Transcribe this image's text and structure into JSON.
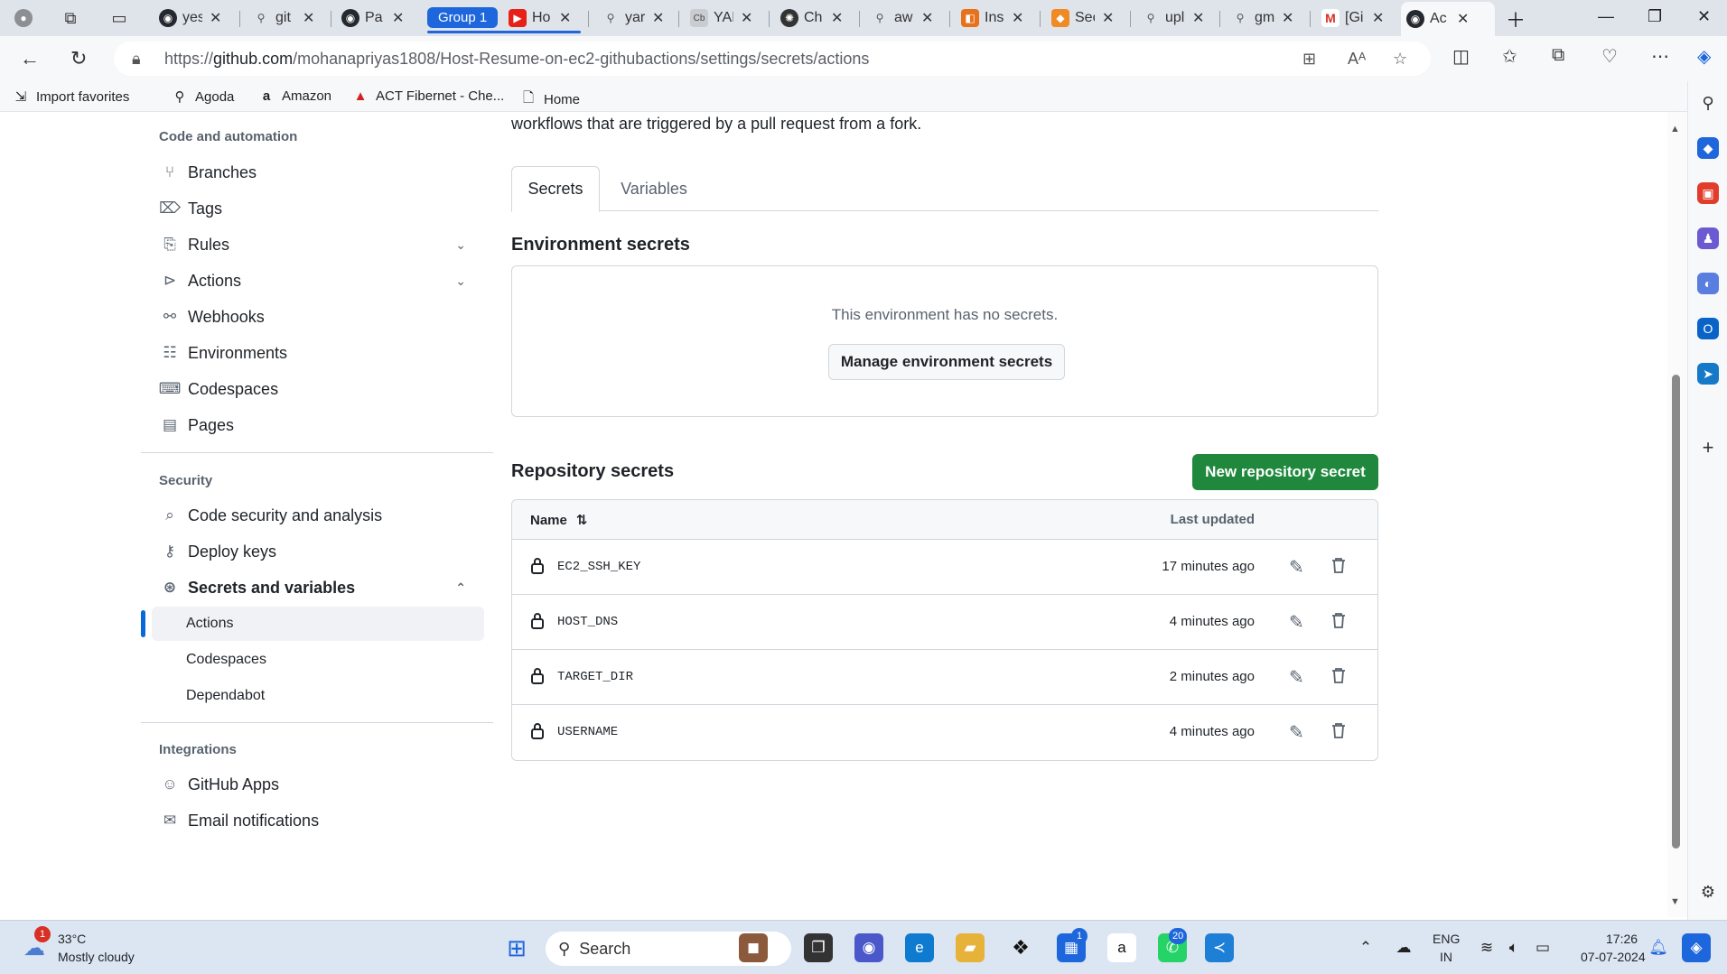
{
  "browser": {
    "tabs": [
      {
        "title": "yes",
        "favicon": "github-icon"
      },
      {
        "title": "git",
        "favicon": "search-icon"
      },
      {
        "title": "Pa",
        "favicon": "github-icon"
      },
      {
        "title": "Ho",
        "favicon": "youtube-icon"
      },
      {
        "title": "yar",
        "favicon": "search-icon"
      },
      {
        "title": "YAI",
        "favicon": "cb-icon"
      },
      {
        "title": "Ch",
        "favicon": "openai-icon"
      },
      {
        "title": "aw",
        "favicon": "search-icon"
      },
      {
        "title": "Ins",
        "favicon": "orange-square-icon"
      },
      {
        "title": "Sec",
        "favicon": "cube-icon"
      },
      {
        "title": "upl",
        "favicon": "search-icon"
      },
      {
        "title": "gm",
        "favicon": "search-icon"
      },
      {
        "title": "[Gi",
        "favicon": "gmail-icon"
      },
      {
        "title": "Ac",
        "favicon": "github-icon"
      }
    ],
    "group_label": "Group 1",
    "url_prefix": "https://",
    "url_host": "github.com",
    "url_path": "/mohanapriyas1808/Host-Resume-on-ec2-githubactions/settings/secrets/actions",
    "favorites": [
      {
        "label": "Import favorites",
        "icon": "import-icon"
      },
      {
        "label": "Agoda",
        "icon": "agoda-icon"
      },
      {
        "label": "Amazon",
        "icon": "amazon-icon"
      },
      {
        "label": "ACT Fibernet - Che...",
        "icon": "act-icon"
      },
      {
        "label": "Home",
        "icon": "page-icon"
      }
    ]
  },
  "sidebar": {
    "code_heading": "Code and automation",
    "code_items": [
      {
        "label": "Branches",
        "icon": "branch-icon"
      },
      {
        "label": "Tags",
        "icon": "tag-icon"
      },
      {
        "label": "Rules",
        "icon": "rules-icon"
      },
      {
        "label": "Actions",
        "icon": "play-icon"
      },
      {
        "label": "Webhooks",
        "icon": "webhook-icon"
      },
      {
        "label": "Environments",
        "icon": "server-icon"
      },
      {
        "label": "Codespaces",
        "icon": "codespaces-icon"
      },
      {
        "label": "Pages",
        "icon": "browser-icon"
      }
    ],
    "security_heading": "Security",
    "security_items": [
      {
        "label": "Code security and analysis",
        "icon": "codescan-icon"
      },
      {
        "label": "Deploy keys",
        "icon": "key-icon"
      },
      {
        "label": "Secrets and variables",
        "icon": "asterisk-icon"
      }
    ],
    "secrets_sub": [
      "Actions",
      "Codespaces",
      "Dependabot"
    ],
    "integrations_heading": "Integrations",
    "integrations_items": [
      {
        "label": "GitHub Apps",
        "icon": "apps-icon"
      },
      {
        "label": "Email notifications",
        "icon": "mail-icon"
      }
    ]
  },
  "main": {
    "intro_text": "workflows that are triggered by a pull request from a fork.",
    "tab_secrets": "Secrets",
    "tab_variables": "Variables",
    "env_heading": "Environment secrets",
    "env_empty": "This environment has no secrets.",
    "env_button": "Manage environment secrets",
    "repo_heading": "Repository secrets",
    "new_secret_button": "New repository secret",
    "col_name": "Name",
    "col_updated": "Last updated",
    "secrets": [
      {
        "name": "EC2_SSH_KEY",
        "updated": "17 minutes ago"
      },
      {
        "name": "HOST_DNS",
        "updated": "4 minutes ago"
      },
      {
        "name": "TARGET_DIR",
        "updated": "2 minutes ago"
      },
      {
        "name": "USERNAME",
        "updated": "4 minutes ago"
      }
    ]
  },
  "taskbar": {
    "weather_temp": "33°C",
    "weather_desc": "Mostly cloudy",
    "weather_badge": "1",
    "search_label": "Search",
    "store_badge": "1",
    "whatsapp_badge": "20",
    "lang": "ENG",
    "region": "IN",
    "time": "17:26",
    "date": "07-07-2024"
  },
  "colors": {
    "primary_button": "#1f883d",
    "active_indicator": "#0969da",
    "tab_group": "#1e66dc"
  }
}
